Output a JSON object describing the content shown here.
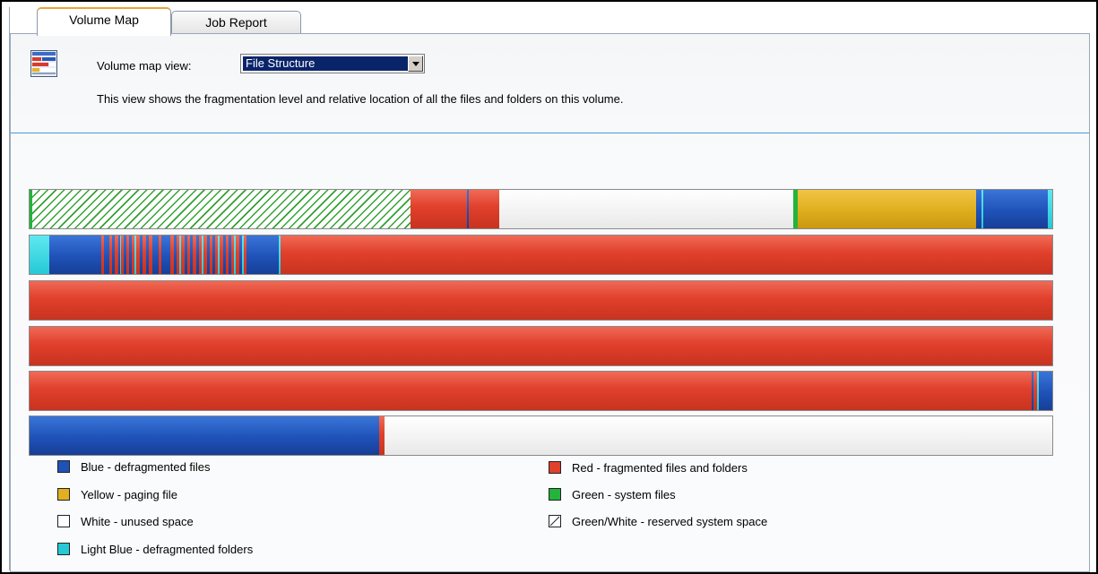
{
  "tabs": [
    {
      "label": "Volume Map",
      "active": true
    },
    {
      "label": "Job Report",
      "active": false
    }
  ],
  "header": {
    "icon": "volume-map-icon",
    "view_label": "Volume map view:",
    "view_selected": "File Structure",
    "description": "This view shows the fragmentation level and relative location of all the files and folders on this volume."
  },
  "colors": {
    "blue": "#1f52b8",
    "red": "#e0402c",
    "yellow": "#e1b021",
    "white": "#ffffff",
    "green": "#22b43b",
    "light_blue": "#25c9d6"
  },
  "legend": {
    "blue": "Blue - defragmented files",
    "yellow": "Yellow - paging file",
    "white": "White - unused space",
    "light_blue": "Light Blue - defragmented folders",
    "red": "Red - fragmented files and folders",
    "green": "Green - system files",
    "reserved": "Green/White - reserved system space"
  }
}
